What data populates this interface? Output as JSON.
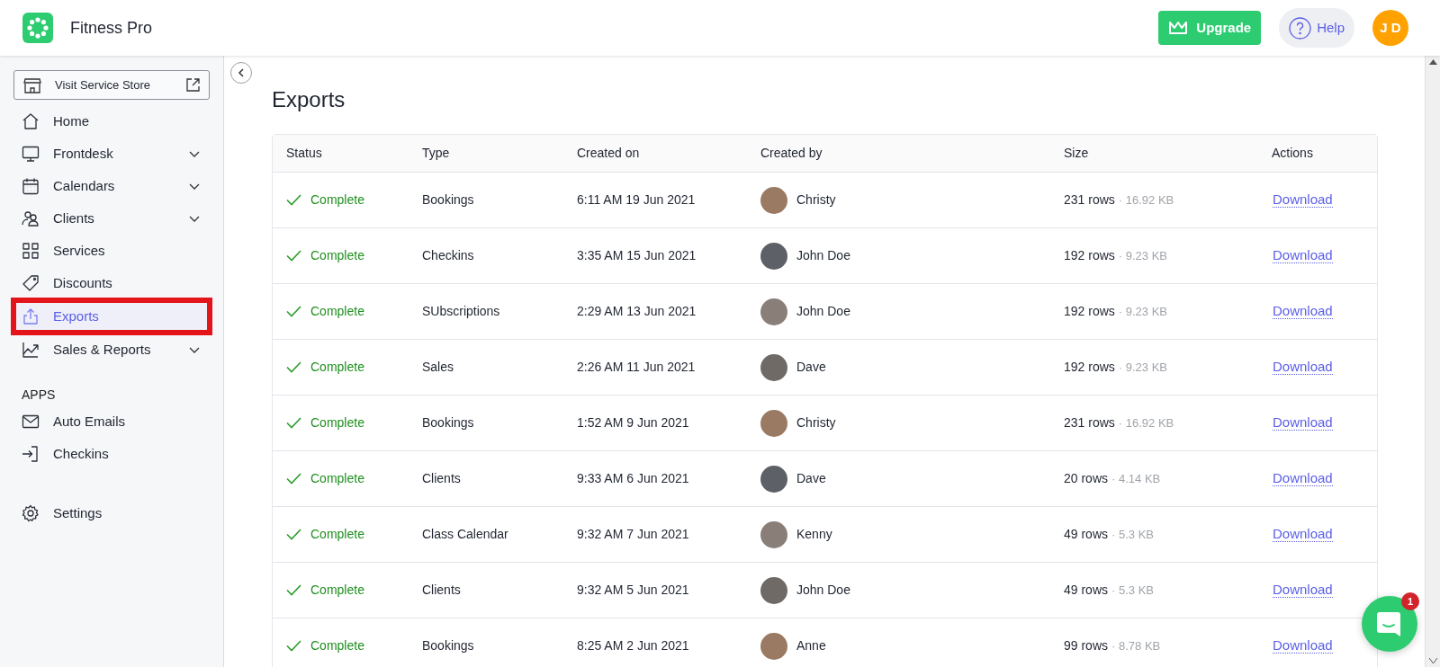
{
  "header": {
    "app_name": "Fitness Pro",
    "upgrade": "Upgrade",
    "help": "Help",
    "avatar_initials": "J D"
  },
  "sidebar": {
    "store_button": "Visit Service Store",
    "items": [
      {
        "label": "Home",
        "has_submenu": false,
        "selected": false
      },
      {
        "label": "Frontdesk",
        "has_submenu": true,
        "selected": false
      },
      {
        "label": "Calendars",
        "has_submenu": true,
        "selected": false
      },
      {
        "label": "Clients",
        "has_submenu": true,
        "selected": false
      },
      {
        "label": "Services",
        "has_submenu": false,
        "selected": false
      },
      {
        "label": "Discounts",
        "has_submenu": false,
        "selected": false
      },
      {
        "label": "Exports",
        "has_submenu": false,
        "selected": true
      },
      {
        "label": "Sales & Reports",
        "has_submenu": true,
        "selected": false
      }
    ],
    "apps_heading": "APPS",
    "apps": [
      {
        "label": "Auto Emails",
        "selected": false
      },
      {
        "label": "Checkins",
        "selected": false
      }
    ],
    "settings": {
      "label": "Settings",
      "selected": false
    }
  },
  "page": {
    "title": "Exports"
  },
  "table": {
    "columns": [
      "Status",
      "Type",
      "Created on",
      "Created by",
      "Size",
      "Actions"
    ],
    "rows": [
      {
        "status": "Complete",
        "type": "Bookings",
        "created_on": "6:11 AM 19 Jun 2021",
        "created_by": "Christy",
        "rows": "231 rows",
        "size": "· 16.92 KB",
        "action": "Download"
      },
      {
        "status": "Complete",
        "type": "Checkins",
        "created_on": "3:35 AM 15 Jun 2021",
        "created_by": "John Doe",
        "rows": "192 rows",
        "size": "· 9.23 KB",
        "action": "Download"
      },
      {
        "status": "Complete",
        "type": "SUbscriptions",
        "created_on": "2:29 AM 13 Jun 2021",
        "created_by": "John Doe",
        "rows": "192 rows",
        "size": "· 9.23 KB",
        "action": "Download"
      },
      {
        "status": "Complete",
        "type": "Sales",
        "created_on": "2:26 AM 11 Jun 2021",
        "created_by": "Dave",
        "rows": "192 rows",
        "size": "· 9.23 KB",
        "action": "Download"
      },
      {
        "status": "Complete",
        "type": "Bookings",
        "created_on": "1:52 AM 9 Jun 2021",
        "created_by": "Christy",
        "rows": "231 rows",
        "size": "· 16.92 KB",
        "action": "Download"
      },
      {
        "status": "Complete",
        "type": "Clients",
        "created_on": "9:33 AM 6 Jun 2021",
        "created_by": "Dave",
        "rows": "20 rows",
        "size": "· 4.14 KB",
        "action": "Download"
      },
      {
        "status": "Complete",
        "type": "Class Calendar",
        "created_on": "9:32 AM 7 Jun 2021",
        "created_by": "Kenny",
        "rows": "49 rows",
        "size": "· 5.3 KB",
        "action": "Download"
      },
      {
        "status": "Complete",
        "type": "Clients",
        "created_on": "9:32 AM 5 Jun 2021",
        "created_by": "John Doe",
        "rows": "49 rows",
        "size": "· 5.3 KB",
        "action": "Download"
      },
      {
        "status": "Complete",
        "type": "Bookings",
        "created_on": "8:25 AM 2 Jun 2021",
        "created_by": "Anne",
        "rows": "99 rows",
        "size": "· 8.78 KB",
        "action": "Download"
      }
    ]
  },
  "chat": {
    "badge": "1"
  }
}
